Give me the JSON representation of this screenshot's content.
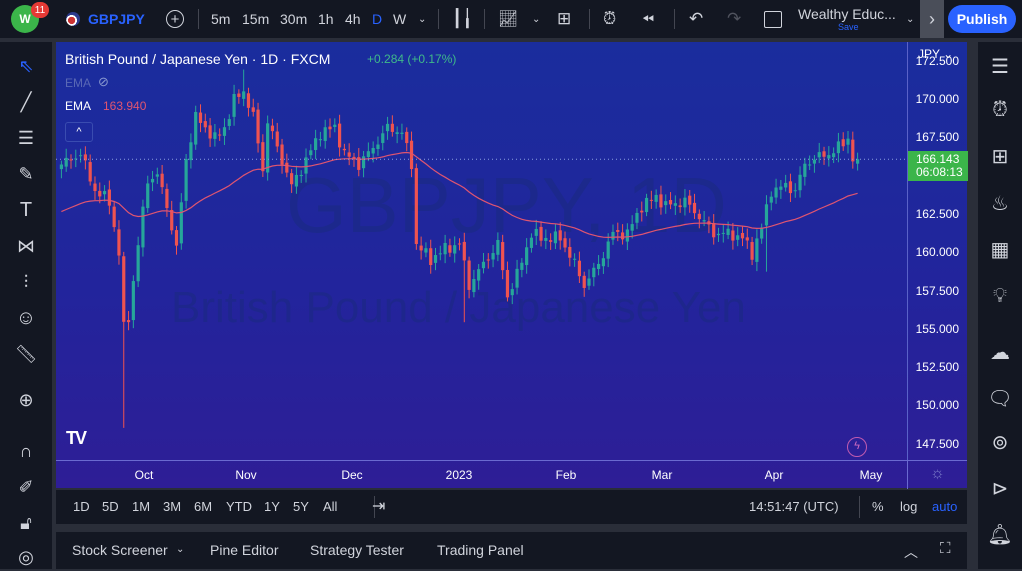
{
  "header": {
    "notifications": "11",
    "symbol": "GBPJPY",
    "intervals": [
      "5m",
      "15m",
      "30m",
      "1h",
      "4h",
      "D",
      "W"
    ],
    "active_interval": "D",
    "layout_name": "Wealthy Educ...",
    "save_label": "Save",
    "publish_label": "Publish"
  },
  "legend": {
    "title": "British Pound / Japanese Yen · 1D · FXCM",
    "change": "+0.284 (+0.17%)",
    "ema_hidden_label": "EMA",
    "ema_label": "EMA",
    "ema_value": "163.940"
  },
  "watermark": {
    "symbol": "GBPJPY, 1D",
    "name": "British Pound / Japanese Yen"
  },
  "price_axis": {
    "currency": "JPY",
    "ticks": [
      "172.500",
      "170.000",
      "167.500",
      "162.500",
      "160.000",
      "157.500",
      "155.000",
      "152.500",
      "150.000",
      "147.500"
    ],
    "last_price": "166.143",
    "countdown": "06:08:13"
  },
  "date_axis": [
    "Oct",
    "Nov",
    "Dec",
    "2023",
    "Feb",
    "Mar",
    "Apr",
    "May"
  ],
  "range_bar": {
    "ranges": [
      "1D",
      "5D",
      "1M",
      "3M",
      "6M",
      "YTD",
      "1Y",
      "5Y",
      "All"
    ],
    "time": "14:51:47 (UTC)",
    "percent": "%",
    "log": "log",
    "auto": "auto"
  },
  "bottom_panel": {
    "tabs": [
      "Stock Screener",
      "Pine Editor",
      "Strategy Tester",
      "Trading Panel"
    ]
  },
  "colors": {
    "up": "#26a69a",
    "down": "#ef5350",
    "ema": "#e05570",
    "accent": "#2962ff"
  },
  "chart_data": {
    "type": "candlestick",
    "symbol": "GBPJPY",
    "ylim": [
      146.5,
      173.8
    ],
    "ema_seed": 162.6,
    "candle_count": 167,
    "close_waypoints": [
      [
        0,
        165.8
      ],
      [
        4,
        166.5
      ],
      [
        7,
        164.1
      ],
      [
        10,
        163.4
      ],
      [
        12,
        160.0
      ],
      [
        13,
        155.1
      ],
      [
        14,
        155.8
      ],
      [
        16,
        160.6
      ],
      [
        18,
        164.8
      ],
      [
        20,
        165.1
      ],
      [
        22,
        163.1
      ],
      [
        24,
        160.3
      ],
      [
        26,
        166.2
      ],
      [
        28,
        168.9
      ],
      [
        32,
        167.5
      ],
      [
        34,
        168.2
      ],
      [
        36,
        170.0
      ],
      [
        38,
        170.6
      ],
      [
        40,
        168.9
      ],
      [
        42,
        165.5
      ],
      [
        43,
        168.6
      ],
      [
        45,
        166.9
      ],
      [
        48,
        164.4
      ],
      [
        50,
        165.5
      ],
      [
        54,
        167.9
      ],
      [
        57,
        168.2
      ],
      [
        59,
        166.5
      ],
      [
        62,
        165.8
      ],
      [
        65,
        166.9
      ],
      [
        68,
        168.2
      ],
      [
        71,
        167.9
      ],
      [
        73,
        165.8
      ],
      [
        74,
        160.6
      ],
      [
        77,
        159.6
      ],
      [
        80,
        160.3
      ],
      [
        83,
        160.6
      ],
      [
        85,
        157.9
      ],
      [
        88,
        159.3
      ],
      [
        91,
        160.6
      ],
      [
        93,
        157.2
      ],
      [
        95,
        158.6
      ],
      [
        98,
        161.3
      ],
      [
        100,
        161.0
      ],
      [
        104,
        161.0
      ],
      [
        107,
        159.3
      ],
      [
        109,
        157.9
      ],
      [
        112,
        159.3
      ],
      [
        115,
        161.3
      ],
      [
        118,
        161.3
      ],
      [
        121,
        163.1
      ],
      [
        124,
        163.7
      ],
      [
        126,
        163.1
      ],
      [
        130,
        163.4
      ],
      [
        133,
        162.4
      ],
      [
        136,
        161.3
      ],
      [
        139,
        161.3
      ],
      [
        142,
        161.0
      ],
      [
        144,
        160.0
      ],
      [
        146,
        161.7
      ],
      [
        148,
        164.1
      ],
      [
        151,
        164.4
      ],
      [
        153,
        164.1
      ],
      [
        155,
        165.8
      ],
      [
        157,
        166.2
      ],
      [
        160,
        166.5
      ],
      [
        162,
        166.9
      ],
      [
        164,
        167.5
      ],
      [
        165,
        166.2
      ],
      [
        166,
        166.1
      ]
    ],
    "wick_extremes": [
      {
        "index": 13,
        "low": 148.6
      },
      {
        "index": 38,
        "high": 172.0
      },
      {
        "index": 84,
        "low": 155.5
      },
      {
        "index": 147,
        "low": 158.8
      }
    ]
  }
}
